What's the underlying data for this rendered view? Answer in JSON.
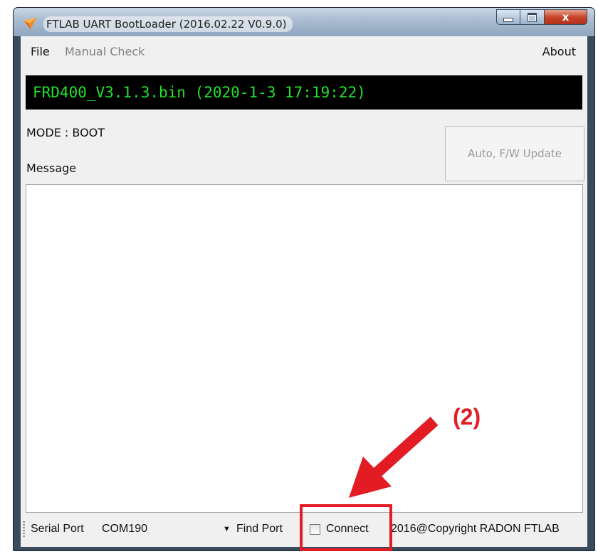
{
  "window": {
    "title": "FTLAB UART BootLoader (2016.02.22 V0.9.0)",
    "icon": "app-icon",
    "controls": {
      "minimize": "minimize-icon",
      "maximize": "maximize-icon",
      "close": "x"
    }
  },
  "menu": {
    "file": "File",
    "manual_check": "Manual Check",
    "about": "About"
  },
  "firmware_file": "FRD400_V3.1.3.bin (2020-1-3 17:19:22)",
  "mode_label": "MODE : BOOT",
  "auto_update_button": "Auto, F/W Update",
  "message_label": "Message",
  "message_content": "",
  "status": {
    "serial_port_label": "Serial Port",
    "serial_port_value": "COM190",
    "find_port": "Find Port",
    "connect_label": "Connect",
    "connect_checked": false,
    "copyright": "2016@Copyright RADON FTLAB"
  },
  "annotation": {
    "label": "(2)",
    "color": "#e31b23"
  },
  "colors": {
    "file_bar_bg": "#000000",
    "file_bar_text": "#22e12f"
  }
}
